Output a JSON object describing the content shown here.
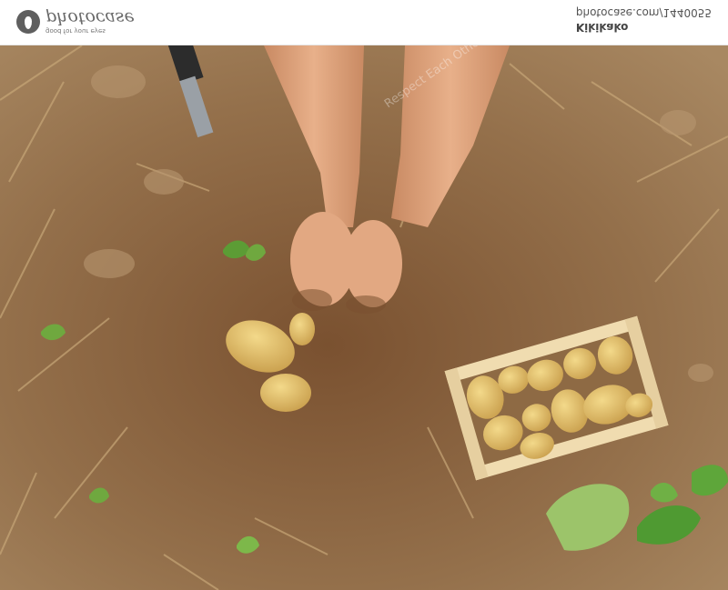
{
  "header": {
    "logo_text": "photocase",
    "logo_tagline": "good for your eyes",
    "source_text": "photocase.com/1440055",
    "author": "Kikikako"
  },
  "photo": {
    "subject": "",
    "watermark": "Respect Each Other"
  },
  "colors": {
    "soil_light": "#a07a52",
    "soil_dark": "#6e4a2c",
    "skin": "#e0a27e",
    "potato": "#e3c06e",
    "crate": "#f0dcb0",
    "leaf": "#6fa83f"
  }
}
